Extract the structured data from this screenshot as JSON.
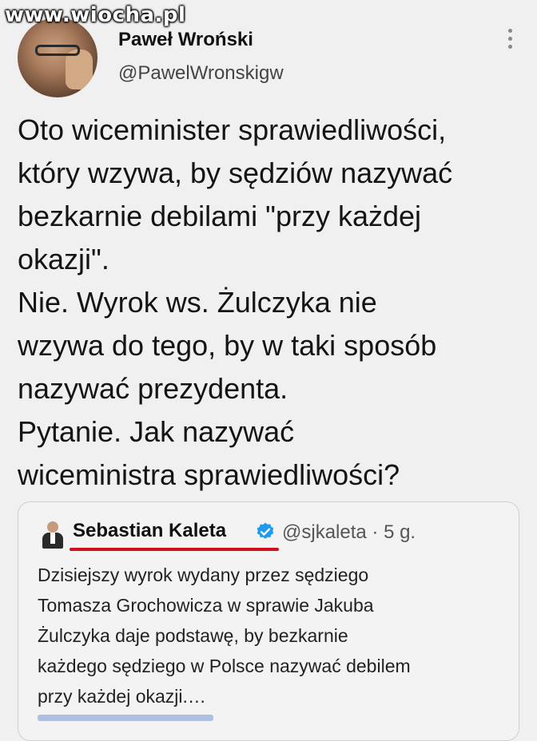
{
  "watermark": "www.wiocha.pl",
  "author": {
    "name": "Paweł Wroński",
    "handle": "@PawelWronskigw"
  },
  "tweet": {
    "lines": [
      "Oto wiceminister sprawiedliwości,",
      "który wzywa, by sędziów nazywać",
      "bezkarnie debilami \"przy każdej",
      "okazji\".",
      "Nie. Wyrok ws. Żulczyka nie",
      "wzywa do tego, by w taki sposób",
      "nazywać prezydenta.",
      "Pytanie. Jak nazywać",
      "wiceministra sprawiedliwości?"
    ]
  },
  "quote": {
    "name": "Sebastian Kaleta",
    "handle_time": "@sjkaleta · 5 g.",
    "lines": [
      "Dzisiejszy wyrok wydany przez sędziego",
      "Tomasza Grochowicza w sprawie Jakuba",
      "Żulczyka daje podstawę, by bezkarnie",
      "każdego sędziego w Polsce nazywać debilem",
      "przy każdej okazji.…"
    ],
    "verified_color": "#1d9bf0",
    "underline_color": "#d0101a"
  },
  "icons": {
    "more": "more-vertical-icon",
    "verified": "verified-badge-icon"
  }
}
